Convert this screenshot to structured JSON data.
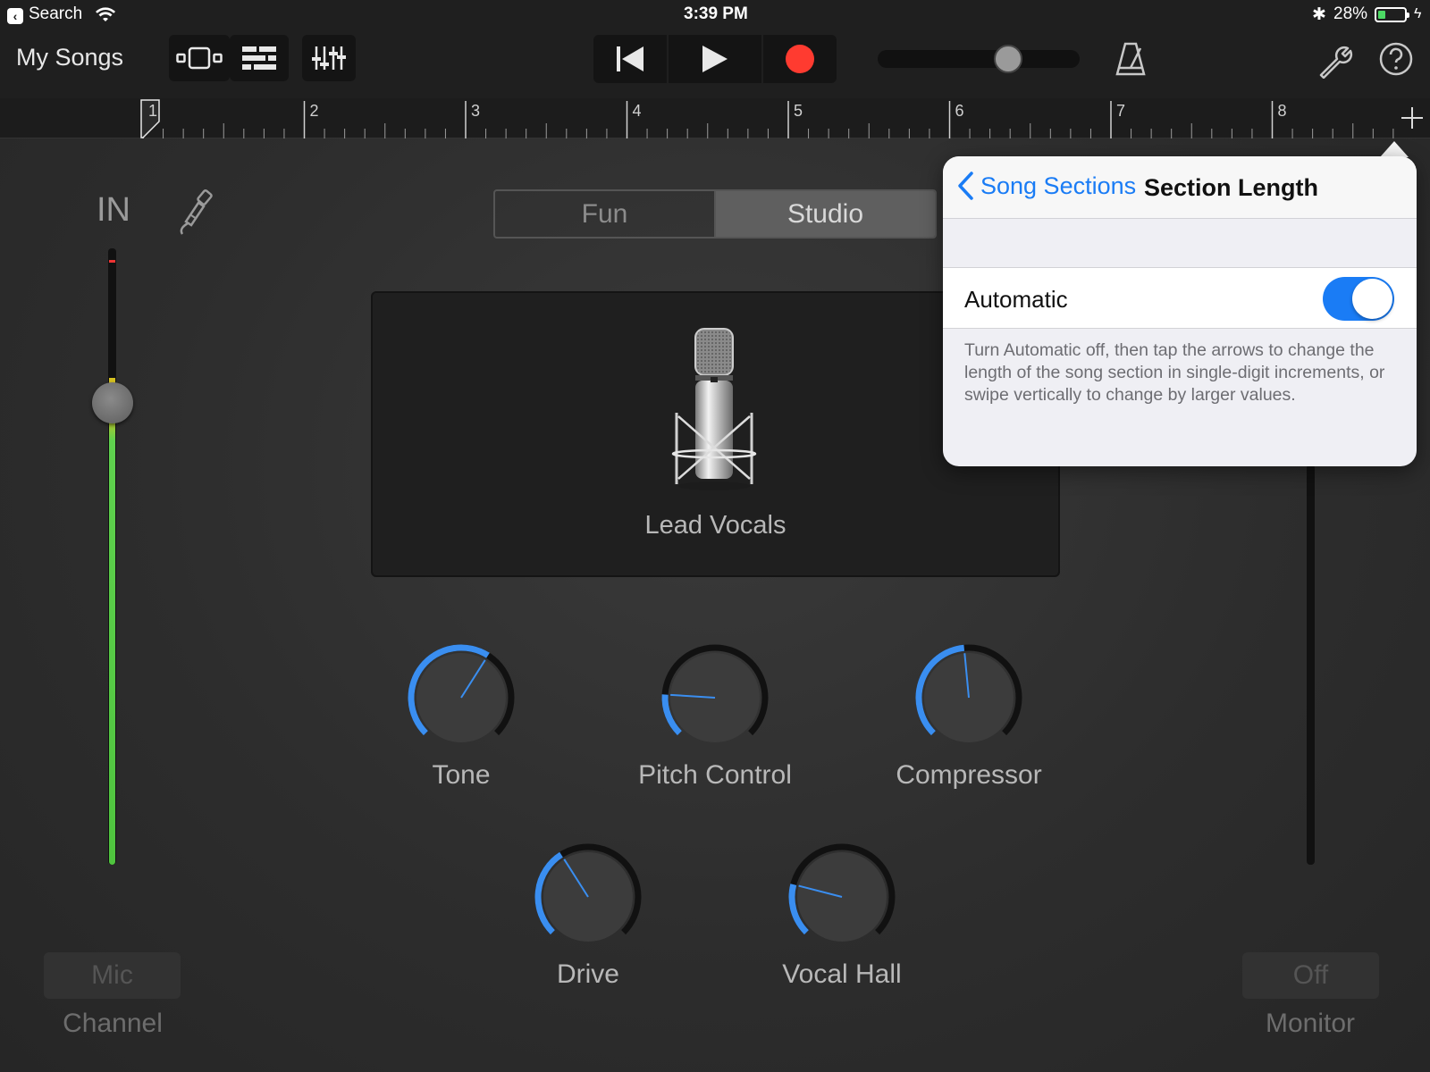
{
  "status_bar": {
    "back_app": "Search",
    "time": "3:39 PM",
    "battery": "28%",
    "battery_level": 0.28
  },
  "toolbar": {
    "my_songs": "My Songs",
    "icons": [
      "tracks-view-icon",
      "arrange-view-icon",
      "mixer-icon",
      "rewind-icon",
      "play-icon",
      "record-icon",
      "metronome-icon",
      "settings-wrench-icon",
      "help-icon"
    ],
    "master_volume": 0.67
  },
  "ruler": {
    "bars": [
      "1",
      "2",
      "3",
      "4",
      "5",
      "6",
      "7",
      "8"
    ],
    "add_icon": "plus-icon"
  },
  "input": {
    "in_label": "IN",
    "input_icon": "guitar-cable-icon",
    "meter_level": 0.79,
    "fader_level": 0.75
  },
  "mode": {
    "tabs": [
      "Fun",
      "Studio"
    ],
    "selected": "Studio"
  },
  "instrument": {
    "name": "Lead Vocals"
  },
  "knobs": [
    {
      "label": "Tone",
      "value": 0.62
    },
    {
      "label": "Pitch Control",
      "value": 0.18
    },
    {
      "label": "Compressor",
      "value": 0.48
    },
    {
      "label": "Drive",
      "value": 0.38
    },
    {
      "label": "Vocal Hall",
      "value": 0.22
    }
  ],
  "channel": {
    "button": "Mic",
    "label": "Channel"
  },
  "monitor": {
    "button": "Off",
    "label": "Monitor"
  },
  "popover": {
    "back": "Song Sections",
    "title": "Section Length",
    "row_label": "Automatic",
    "toggle_on": true,
    "footer": "Turn Automatic off, then tap the arrows to change the length of the song section in single-digit increments, or swipe vertically to change by larger values."
  },
  "colors": {
    "accent_blue": "#1a7cf5",
    "knob_arc": "#3a8ef0",
    "record_red": "#ff3b30",
    "meter_green": "#4fc43e"
  }
}
